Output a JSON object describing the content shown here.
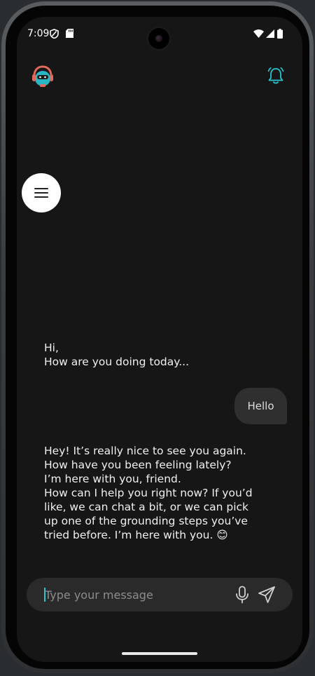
{
  "status_bar": {
    "time": "7:09"
  },
  "header": {
    "avatar_icon": "robot-headphones-avatar-icon",
    "notification_icon": "bell-icon"
  },
  "menu_button": {
    "icon": "hamburger-menu-icon"
  },
  "messages": [
    {
      "role": "bot",
      "text": "Hi,\nHow are you doing today..."
    },
    {
      "role": "user",
      "text": "Hello"
    },
    {
      "role": "bot",
      "text": "Hey! It’s really nice to see you again. How have you been feeling lately?\nI’m here with you, friend.\nHow can I help you right now? If you’d like, we can chat a bit, or we can pick up one of the grounding steps you’ve tried before. I’m here with you. 😊"
    }
  ],
  "composer": {
    "placeholder": "Type your message",
    "value": "",
    "mic_icon": "microphone-icon",
    "send_icon": "send-icon"
  },
  "colors": {
    "background": "#161616",
    "accent": "#29c6d1",
    "bubble_user": "#2f2f2f",
    "input_bg": "#2a2a2a"
  }
}
